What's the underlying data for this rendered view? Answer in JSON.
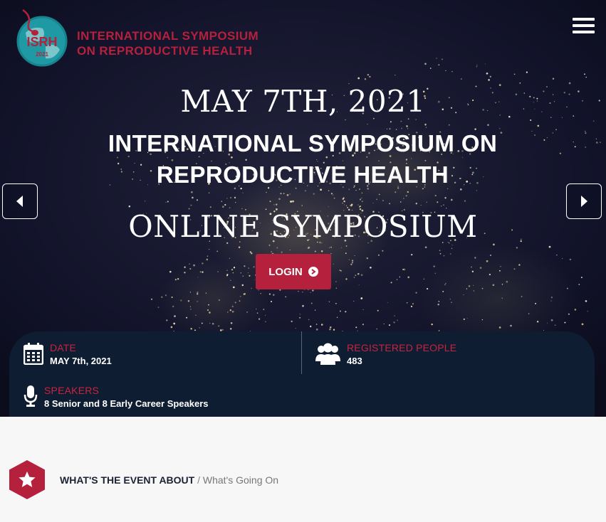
{
  "header": {
    "logo_text": "ISRH",
    "logo_year": "2021",
    "org_line1": "INTERNATIONAL SYMPOSIUM",
    "org_line2": "ON REPRODUCTIVE HEALTH",
    "menu_icon": "hamburger-menu-icon"
  },
  "hero": {
    "date": "MAY 7TH, 2021",
    "title_line1": "INTERNATIONAL SYMPOSIUM ON",
    "title_line2": "REPRODUCTIVE HEALTH",
    "subtitle": "ONLINE SYMPOSIUM",
    "login_label": "LOGIN",
    "prev_icon": "caret-left-icon",
    "next_icon": "caret-right-icon"
  },
  "info": {
    "date": {
      "label": "DATE",
      "value": "MAY 7th, 2021",
      "icon": "calendar-icon"
    },
    "registered": {
      "label": "REGISTERED PEOPLE",
      "value": "483",
      "icon": "users-icon"
    },
    "speakers": {
      "label": "SPEAKERS",
      "value": "8 Senior and 8 Early Career Speakers",
      "icon": "microphone-icon"
    }
  },
  "section": {
    "icon": "star-icon",
    "heading": "WHAT'S THE EVENT ABOUT",
    "separator": "/",
    "subheading": "What's Going On"
  },
  "colors": {
    "accent": "#b5213c",
    "panel": "#0e1d31",
    "logo_teal": "#1f9aa5"
  }
}
